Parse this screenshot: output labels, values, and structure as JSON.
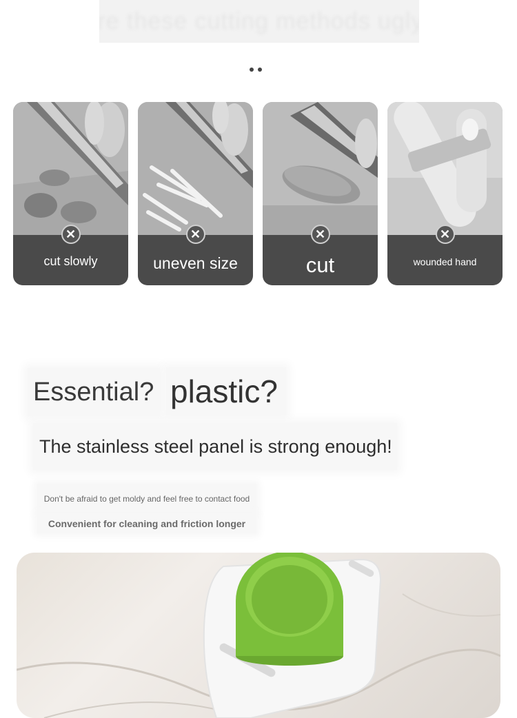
{
  "banner": {
    "title": "Are these cutting methods ugly?"
  },
  "carousel": {
    "dots": 2
  },
  "problems": [
    {
      "label": "cut slowly",
      "mark": "✕"
    },
    {
      "label": "uneven size",
      "mark": "✕"
    },
    {
      "label": "cut",
      "mark": "✕"
    },
    {
      "label": "wounded hand",
      "mark": "✕"
    }
  ],
  "headline": {
    "essential": "Essential?",
    "plastic": "plastic?",
    "statement": "The stainless steel panel is strong enough!"
  },
  "subtext": {
    "line1": "Don't be afraid to get moldy and feel free to contact food",
    "line2": "Convenient for cleaning and friction longer"
  },
  "colors": {
    "label_bg": "#4a4a4a",
    "product_green": "#7bbf3a"
  }
}
